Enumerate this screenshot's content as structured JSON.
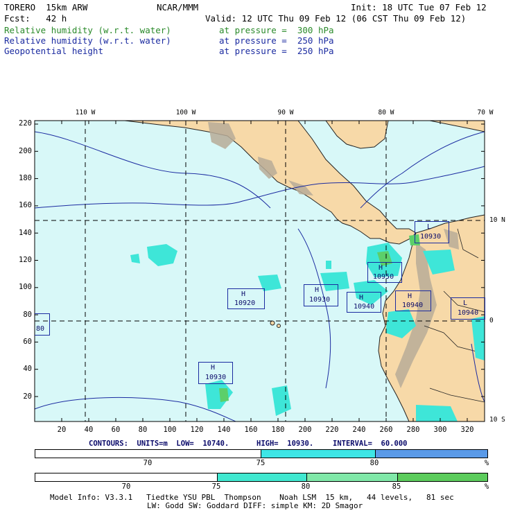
{
  "header": {
    "model": "TORERO  15km ARW",
    "org": "NCAR/MMM",
    "init": "Init: 18 UTC Tue 07 Feb 12",
    "fcst": "Fcst:   42 h",
    "valid": "Valid: 12 UTC Thu 09 Feb 12 (06 CST Thu 09 Feb 12)",
    "fields": [
      {
        "name": "Relative humidity (w.r.t. water)",
        "level": "at pressure =  300 hPa",
        "color": "#2a8a2a"
      },
      {
        "name": "Relative humidity (w.r.t. water)",
        "level": "at pressure =  250 hPa",
        "color": "#1a2aa0"
      },
      {
        "name": "Geopotential height",
        "level": "at pressure =  250 hPa",
        "color": "#1a2aa0"
      }
    ]
  },
  "map": {
    "x_ticks": [
      "20",
      "40",
      "60",
      "80",
      "100",
      "120",
      "140",
      "160",
      "180",
      "200",
      "220",
      "240",
      "260",
      "280",
      "300",
      "320"
    ],
    "y_ticks": [
      "20",
      "40",
      "60",
      "80",
      "100",
      "120",
      "140",
      "160",
      "180",
      "200",
      "220"
    ],
    "lon_labels": [
      "110 W",
      "100 W",
      "90 W",
      "80 W",
      "70 W"
    ],
    "lat_labels": [
      "10 N",
      "0",
      "10 S"
    ],
    "colors": {
      "ocean": "#d8f8f8",
      "land": "#f7d9a8",
      "terrain": "#b8ac98",
      "rh_low": "#3ee6d8",
      "rh_high": "#5ccf6a"
    },
    "centers": [
      {
        "type": "H",
        "value": "10920"
      },
      {
        "type": "H",
        "value": "10930"
      },
      {
        "type": "H",
        "value": "10940"
      },
      {
        "type": "H",
        "value": "10950"
      },
      {
        "type": "H",
        "value": "10940"
      },
      {
        "type": "L",
        "value": "10930"
      },
      {
        "type": "L",
        "value": "10940"
      },
      {
        "type": "H",
        "value": "10930"
      },
      {
        "type": "",
        "value": "80"
      }
    ]
  },
  "contours_line": {
    "label": "CONTOURS:  UNITS=m  LOW=  10740.",
    "high": "HIGH=  10930.",
    "interval": "INTERVAL=  60.000"
  },
  "colorbar1": {
    "labels": [
      "70",
      "75",
      "80"
    ],
    "unit": "%",
    "colors": [
      "#ffffff",
      "#3ee6e6",
      "#5a9ae8"
    ]
  },
  "colorbar2": {
    "labels": [
      "70",
      "75",
      "80",
      "85"
    ],
    "unit": "%",
    "colors": [
      "#ffffff",
      "#40e8d0",
      "#80e8a8",
      "#5ccc5c"
    ]
  },
  "footer": {
    "line1": "Model Info: V3.3.1   Tiedtke YSU PBL  Thompson    Noah LSM  15 km,   44 levels,   81 sec",
    "line2": "LW: Godd SW: Goddard DIFF: simple KM: 2D Smagor"
  }
}
